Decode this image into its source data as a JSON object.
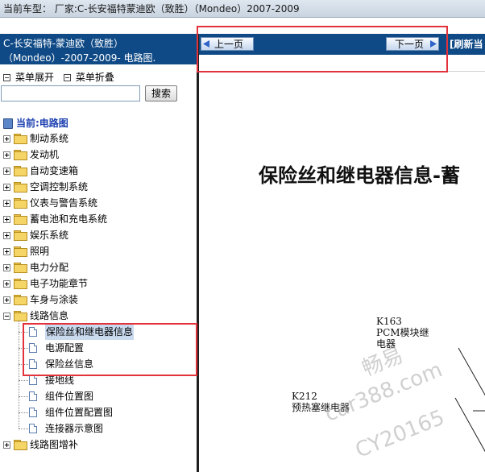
{
  "topbar": {
    "text": "当前车型： 厂家:C-长安福特蒙迪欧（致胜）（Mondeo）2007-2009"
  },
  "left_header": {
    "line1": "C-长安福特-蒙迪欧（致胜）",
    "line2": "（Mondeo）-2007-2009- 电路图."
  },
  "toolbar": {
    "expand_label": "菜单展开",
    "collapse_label": "菜单折叠",
    "search_button": "搜索",
    "search_value": ""
  },
  "tree": {
    "current_label": "当前:电路图",
    "categories": [
      "制动系统",
      "发动机",
      "自动变速箱",
      "空调控制系统",
      "仪表与警告系统",
      "蓄电池和充电系统",
      "娱乐系统",
      "照明",
      "电力分配",
      "电子功能章节",
      "车身与涂装",
      "线路信息"
    ],
    "open_children": [
      "保险丝和继电器信息",
      "电源配置",
      "保险丝信息",
      "接地线",
      "组件位置图",
      "组件位置配置图",
      "连接器示意图"
    ],
    "last_category": "线路图增补"
  },
  "nav": {
    "prev_label": "上一页",
    "next_label": "下一页",
    "refresh_label": "[刷新当"
  },
  "document": {
    "title": "保险丝和继电器信息-蓄",
    "k163_lines": [
      "K163",
      "PCM模块继",
      "电器"
    ],
    "k212_lines": [
      "K212",
      "预热塞继电器"
    ]
  },
  "watermark": {
    "line1": "畅易",
    "line2": "car388.com",
    "line3": "CY20165"
  }
}
